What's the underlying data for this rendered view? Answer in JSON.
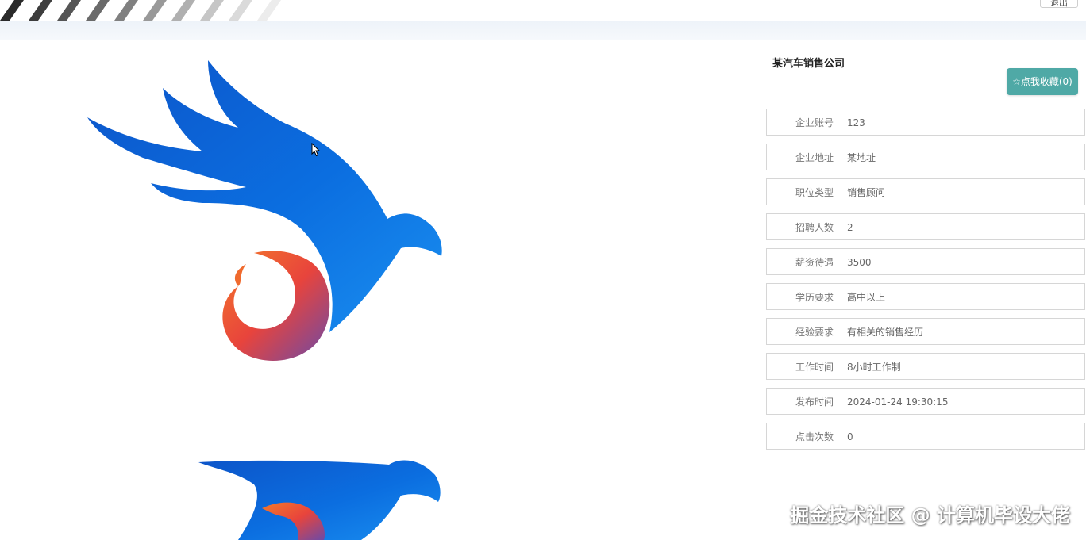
{
  "topbar": {
    "button_label": "退出"
  },
  "job": {
    "company_name": "某汽车销售公司",
    "favorite_button": "☆点我收藏(0)",
    "fields": [
      {
        "label": "企业账号",
        "value": "123"
      },
      {
        "label": "企业地址",
        "value": "某地址"
      },
      {
        "label": "职位类型",
        "value": "销售顾问"
      },
      {
        "label": "招聘人数",
        "value": "2"
      },
      {
        "label": "薪资待遇",
        "value": "3500"
      },
      {
        "label": "学历要求",
        "value": "高中以上"
      },
      {
        "label": "经验要求",
        "value": "有相关的销售经历"
      },
      {
        "label": "工作时间",
        "value": "8小时工作制"
      },
      {
        "label": "发布时间",
        "value": "2024-01-24 19:30:15"
      },
      {
        "label": "点击次数",
        "value": "0"
      }
    ]
  },
  "watermark": "掘金技术社区 @ 计算机毕设大佬",
  "colors": {
    "favorite_button_bg": "#4fa9a6",
    "logo_blue": "#0a64d6",
    "logo_orange": "#f2582a"
  },
  "icons": {
    "cursor": "pointer-cursor-icon",
    "logo": "eagle-logo-icon"
  }
}
